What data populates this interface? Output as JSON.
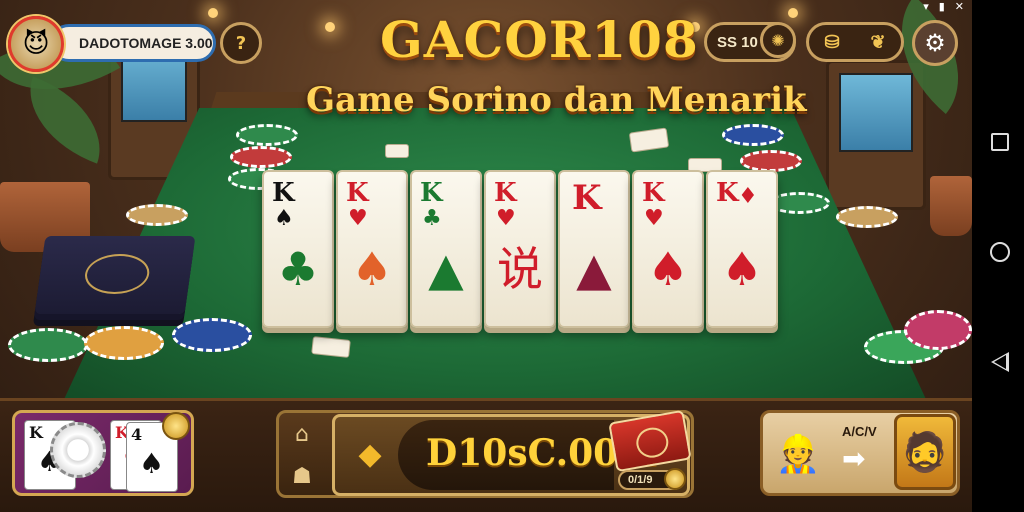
{
  "game": {
    "title": "GACOR108",
    "subtitle": "Game Sorino dan Menarik"
  },
  "top_hud": {
    "player_name_label": "DADOTOMAGE 3.00",
    "hint_icon": "?",
    "level_label": "SS 10"
  },
  "tiles": [
    {
      "rank": "K",
      "pip": "♠",
      "big": "♣",
      "rank_color": "black",
      "big_color": "green"
    },
    {
      "rank": "K",
      "pip": "♥",
      "big": "♠",
      "rank_color": "red",
      "big_color": "red"
    },
    {
      "rank": "K",
      "pip": "♣",
      "big": "▲",
      "rank_color": "green",
      "big_color": "green"
    },
    {
      "rank": "K",
      "pip": "♥",
      "big": "说",
      "rank_color": "red",
      "big_color": "red"
    },
    {
      "rank": "K",
      "pip": "",
      "big": "▲",
      "rank_color": "red",
      "big_color": "red"
    },
    {
      "rank": "K",
      "pip": "♥",
      "big": "♠",
      "rank_color": "red",
      "big_color": "red"
    },
    {
      "rank": "K",
      "pip": "♦",
      "big": "♠",
      "rank_color": "red",
      "big_color": "red"
    }
  ],
  "bottom_bar": {
    "balance_value": "D10sC.00M",
    "small_badge": "0/1/9",
    "arrow_label": "A/C/V"
  },
  "colors": {
    "title_gold": "#ffd23f",
    "felt_green": "#1d6a36",
    "frame_gold": "#d6b066",
    "panel_purple": "#7a2a6a"
  },
  "icons": [
    "avatar-icon",
    "hint-icon",
    "compass-icon",
    "bag-icon",
    "gear-icon",
    "home-icon",
    "diamond-icon",
    "treasure-box-icon",
    "coin-icon",
    "arrow-right-icon",
    "hero-icon",
    "square-nav-icon",
    "circle-nav-icon",
    "back-nav-icon"
  ]
}
